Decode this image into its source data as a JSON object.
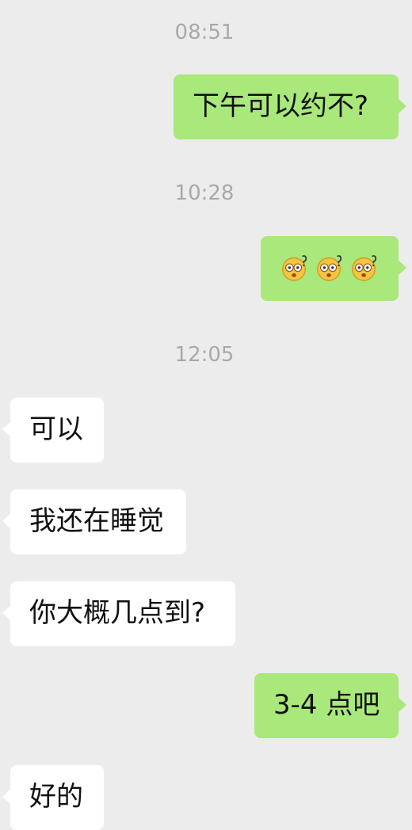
{
  "chat": {
    "timestamps": [
      "08:51",
      "10:28",
      "12:05"
    ],
    "messages": [
      {
        "side": "out",
        "text": "下午可以约不?"
      },
      {
        "side": "out",
        "emoji": [
          "dizzy-face-emoji",
          "dizzy-face-emoji",
          "dizzy-face-emoji"
        ]
      },
      {
        "side": "in",
        "text": "可以"
      },
      {
        "side": "in",
        "text": "我还在睡觉"
      },
      {
        "side": "in",
        "text": "你大概几点到?"
      },
      {
        "side": "out",
        "text": "3-4 点吧"
      },
      {
        "side": "in",
        "text": "好的"
      }
    ]
  },
  "colors": {
    "background": "#ececec",
    "outgoing_bubble": "#a9e87a",
    "incoming_bubble": "#ffffff",
    "timestamp_text": "#a9a9a9",
    "message_text": "#111111"
  }
}
